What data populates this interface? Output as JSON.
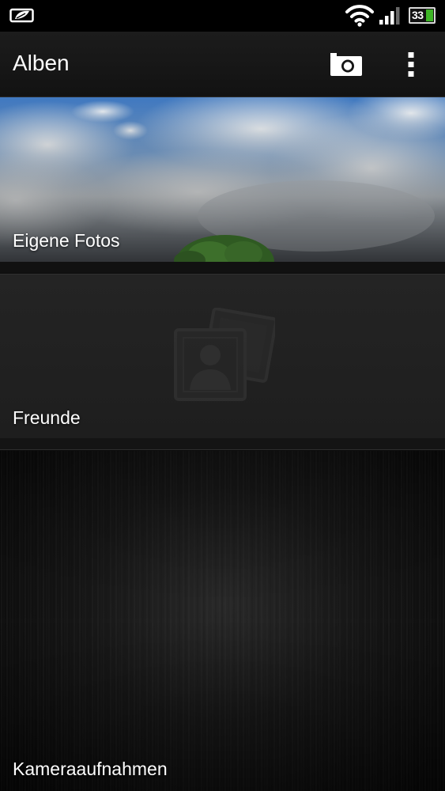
{
  "status_bar": {
    "left_icon": "htc-sense-leaf-icon",
    "wifi_icon": "wifi-icon",
    "signal_icon": "signal-bars-icon",
    "battery_level": "33",
    "battery_fill_color": "#3db526"
  },
  "action_bar": {
    "title": "Alben",
    "camera_icon": "camera-icon",
    "overflow_icon": "overflow-menu-icon"
  },
  "albums": [
    {
      "label": "Eigene Fotos",
      "thumbnail": "sky-clouds-photo"
    },
    {
      "label": "Freunde",
      "thumbnail": "people-photos-placeholder-icon"
    },
    {
      "label": "Kameraaufnahmen",
      "thumbnail": "brushed-metal-texture"
    }
  ]
}
